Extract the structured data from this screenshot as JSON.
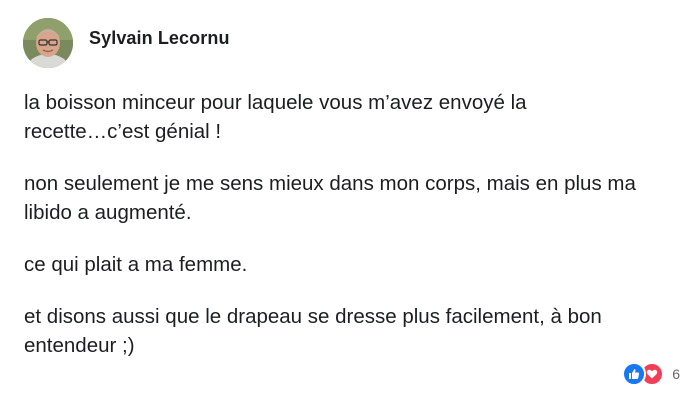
{
  "post": {
    "author_name": "Sylvain Lecornu",
    "avatar_icon": "user-avatar",
    "paragraphs": [
      "la boisson minceur pour laquele vous m’avez envoyé la\nrecette…c’est génial !",
      "non seulement je me sens mieux dans mon corps, mais en plus ma\nlibido a augmenté.",
      "ce qui plait a ma femme.",
      "et disons aussi que le drapeau se dresse plus facilement, à bon\nentendeur ;)"
    ],
    "reactions": {
      "icons": [
        "like-icon",
        "love-icon"
      ],
      "count": "6"
    }
  },
  "colors": {
    "like": "#1877f2",
    "love": "#f33e58",
    "text": "#1c1e21",
    "muted": "#65676b"
  }
}
